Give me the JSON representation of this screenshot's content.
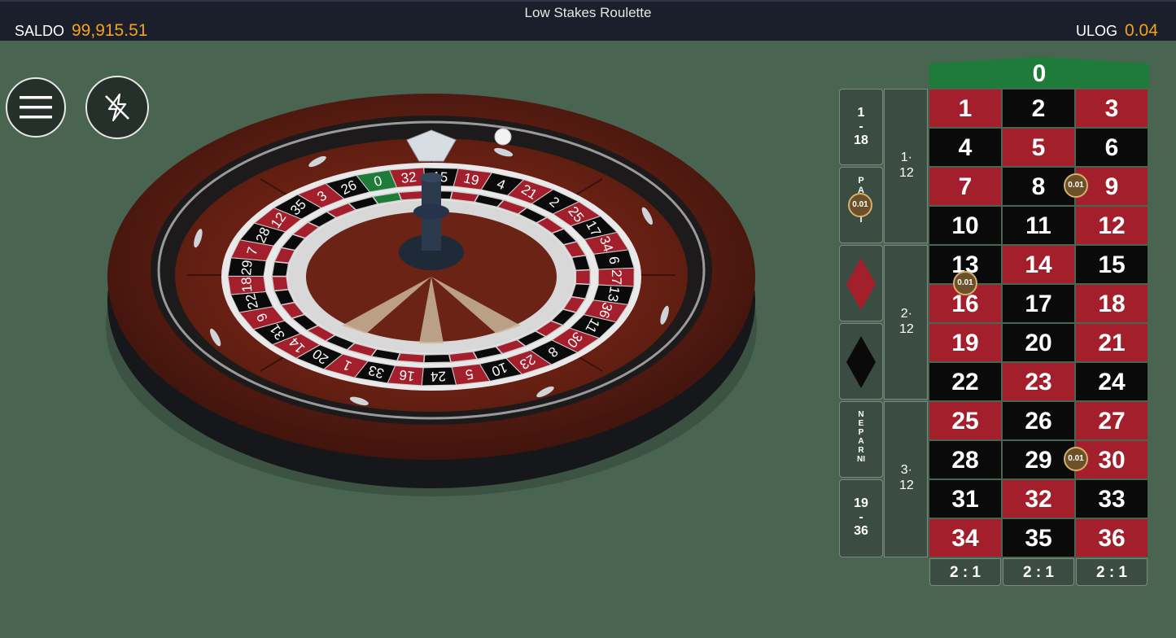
{
  "header": {
    "title": "Low Stakes Roulette",
    "balance_label": "SALDO",
    "balance_value": "99,915.51",
    "bet_label": "ULOG",
    "bet_value": "0.04"
  },
  "controls": {
    "menu_icon": "hamburger-menu-icon",
    "turbo_icon": "turbo-off-icon"
  },
  "table": {
    "zero": "0",
    "red_numbers": [
      1,
      3,
      5,
      7,
      9,
      12,
      14,
      16,
      18,
      19,
      21,
      23,
      25,
      27,
      30,
      32,
      34,
      36
    ],
    "rows": [
      [
        "1",
        "2",
        "3"
      ],
      [
        "4",
        "5",
        "6"
      ],
      [
        "7",
        "8",
        "9"
      ],
      [
        "10",
        "11",
        "12"
      ],
      [
        "13",
        "14",
        "15"
      ],
      [
        "16",
        "17",
        "18"
      ],
      [
        "19",
        "20",
        "21"
      ],
      [
        "22",
        "23",
        "24"
      ],
      [
        "25",
        "26",
        "27"
      ],
      [
        "28",
        "29",
        "30"
      ],
      [
        "31",
        "32",
        "33"
      ],
      [
        "34",
        "35",
        "36"
      ]
    ],
    "dozens": [
      "1·\n12",
      "2·\n12",
      "3·\n12"
    ],
    "low_label": "1\n-\n18",
    "high_label": "19\n-\n36",
    "even_label": "PARNI",
    "odd_label": "NEPARNI",
    "columns": [
      "2 : 1",
      "2 : 1",
      "2 : 1"
    ],
    "chips": [
      {
        "value": "0.01",
        "bet": "even"
      },
      {
        "value": "0.01",
        "bet": "8-9"
      },
      {
        "value": "0.01",
        "bet": "13-16"
      },
      {
        "value": "0.01",
        "bet": "29-30"
      }
    ],
    "colors": {
      "red": "#a41f2c",
      "black": "#0a0a0a",
      "green": "#1e7b3a",
      "accent": "#f3a31d"
    }
  },
  "wheel": {
    "sequence": [
      "0",
      "32",
      "15",
      "19",
      "4",
      "21",
      "2",
      "25",
      "17",
      "34",
      "6",
      "27",
      "13",
      "36",
      "11",
      "30",
      "8",
      "23",
      "10",
      "5",
      "24",
      "16",
      "33",
      "1",
      "20",
      "14",
      "31",
      "9",
      "22",
      "18",
      "29",
      "7",
      "28",
      "12",
      "35",
      "3",
      "26"
    ]
  }
}
